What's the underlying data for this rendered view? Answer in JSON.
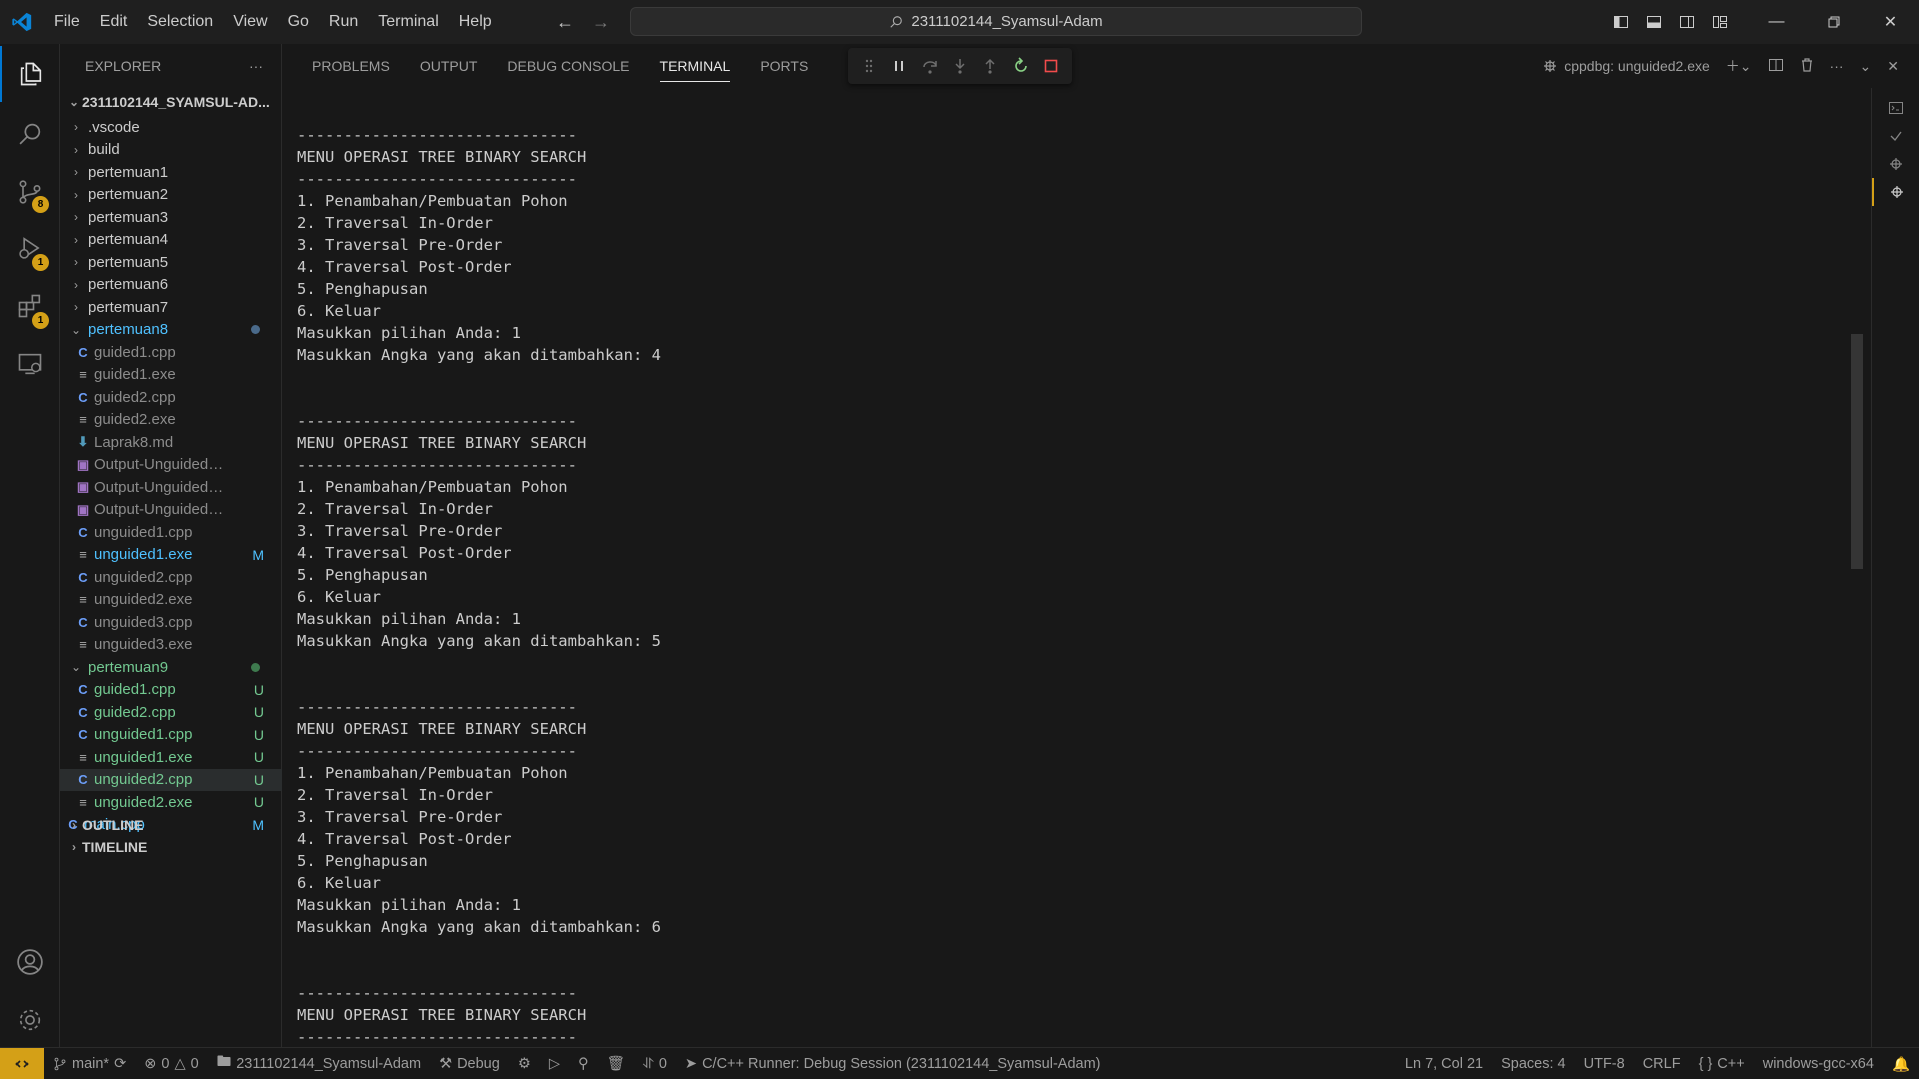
{
  "titlebar": {
    "menus": [
      "File",
      "Edit",
      "Selection",
      "View",
      "Go",
      "Run",
      "Terminal",
      "Help"
    ],
    "search_text": "2311102144_Syamsul-Adam"
  },
  "activity": {
    "scm_badge": "8",
    "debug_badge": "1",
    "extensions_badge": "1"
  },
  "explorer": {
    "title": "EXPLORER",
    "more": "···",
    "root": "2311102144_SYAMSUL-AD...",
    "items": [
      {
        "label": ".vscode",
        "kind": "folder",
        "color": "#cccccc"
      },
      {
        "label": "build",
        "kind": "folder",
        "color": "#cccccc"
      },
      {
        "label": "pertemuan1",
        "kind": "folder",
        "color": "#cccccc"
      },
      {
        "label": "pertemuan2",
        "kind": "folder",
        "color": "#cccccc"
      },
      {
        "label": "pertemuan3",
        "kind": "folder",
        "color": "#cccccc"
      },
      {
        "label": "pertemuan4",
        "kind": "folder",
        "color": "#cccccc"
      },
      {
        "label": "pertemuan5",
        "kind": "folder",
        "color": "#cccccc"
      },
      {
        "label": "pertemuan6",
        "kind": "folder",
        "color": "#cccccc"
      },
      {
        "label": "pertemuan7",
        "kind": "folder",
        "color": "#cccccc"
      },
      {
        "label": "pertemuan8",
        "kind": "open-folder",
        "color": "#4fc1ff",
        "dot": "#4a6a8a"
      },
      {
        "label": "guided1.cpp",
        "kind": "cpp",
        "color": "#8c8c8c"
      },
      {
        "label": "guided1.exe",
        "kind": "exe",
        "color": "#8c8c8c"
      },
      {
        "label": "guided2.cpp",
        "kind": "cpp",
        "color": "#8c8c8c"
      },
      {
        "label": "guided2.exe",
        "kind": "exe",
        "color": "#8c8c8c"
      },
      {
        "label": "Laprak8.md",
        "kind": "md",
        "color": "#8c8c8c"
      },
      {
        "label": "Output-Unguided-1...",
        "kind": "img",
        "color": "#8c8c8c"
      },
      {
        "label": "Output-Unguided-2...",
        "kind": "img",
        "color": "#8c8c8c"
      },
      {
        "label": "Output-Unguided-3...",
        "kind": "img",
        "color": "#8c8c8c"
      },
      {
        "label": "unguided1.cpp",
        "kind": "cpp",
        "color": "#8c8c8c"
      },
      {
        "label": "unguided1.exe",
        "kind": "exe",
        "color": "#4fc1ff",
        "deco": "M",
        "deco_color": "#4fc1ff"
      },
      {
        "label": "unguided2.cpp",
        "kind": "cpp",
        "color": "#8c8c8c"
      },
      {
        "label": "unguided2.exe",
        "kind": "exe",
        "color": "#8c8c8c"
      },
      {
        "label": "unguided3.cpp",
        "kind": "cpp",
        "color": "#8c8c8c"
      },
      {
        "label": "unguided3.exe",
        "kind": "exe",
        "color": "#8c8c8c"
      },
      {
        "label": "pertemuan9",
        "kind": "open-folder",
        "color": "#73c991",
        "dot": "#3e7a4e"
      },
      {
        "label": "guided1.cpp",
        "kind": "cpp",
        "color": "#73c991",
        "deco": "U",
        "deco_color": "#73c991"
      },
      {
        "label": "guided2.cpp",
        "kind": "cpp",
        "color": "#73c991",
        "deco": "U",
        "deco_color": "#73c991"
      },
      {
        "label": "unguided1.cpp",
        "kind": "cpp",
        "color": "#73c991",
        "deco": "U",
        "deco_color": "#73c991"
      },
      {
        "label": "unguided1.exe",
        "kind": "exe",
        "color": "#73c991",
        "deco": "U",
        "deco_color": "#73c991"
      },
      {
        "label": "unguided2.cpp",
        "kind": "cpp",
        "color": "#73c991",
        "deco": "U",
        "deco_color": "#73c991",
        "selected": true
      },
      {
        "label": "unguided2.exe",
        "kind": "exe",
        "color": "#73c991",
        "deco": "U",
        "deco_color": "#73c991"
      },
      {
        "label": "main.cpp",
        "kind": "cpp",
        "color": "#4fc1ff",
        "deco": "M",
        "deco_color": "#4fc1ff"
      }
    ],
    "outline": "OUTLINE",
    "timeline": "TIMELINE"
  },
  "panel": {
    "tabs": [
      "PROBLEMS",
      "OUTPUT",
      "DEBUG CONSOLE",
      "TERMINAL",
      "PORTS"
    ],
    "active_tab": "TERMINAL",
    "session": "cppdbg: unguided2.exe",
    "terminal_lines": [
      "",
      "------------------------------",
      "MENU OPERASI TREE BINARY SEARCH",
      "------------------------------",
      "1. Penambahan/Pembuatan Pohon",
      "2. Traversal In-Order",
      "3. Traversal Pre-Order",
      "4. Traversal Post-Order",
      "5. Penghapusan",
      "6. Keluar",
      "Masukkan pilihan Anda: 1",
      "Masukkan Angka yang akan ditambahkan: 4",
      "",
      "",
      "------------------------------",
      "MENU OPERASI TREE BINARY SEARCH",
      "------------------------------",
      "1. Penambahan/Pembuatan Pohon",
      "2. Traversal In-Order",
      "3. Traversal Pre-Order",
      "4. Traversal Post-Order",
      "5. Penghapusan",
      "6. Keluar",
      "Masukkan pilihan Anda: 1",
      "Masukkan Angka yang akan ditambahkan: 5",
      "",
      "",
      "------------------------------",
      "MENU OPERASI TREE BINARY SEARCH",
      "------------------------------",
      "1. Penambahan/Pembuatan Pohon",
      "2. Traversal In-Order",
      "3. Traversal Pre-Order",
      "4. Traversal Post-Order",
      "5. Penghapusan",
      "6. Keluar",
      "Masukkan pilihan Anda: 1",
      "Masukkan Angka yang akan ditambahkan: 6",
      "",
      "",
      "------------------------------",
      "MENU OPERASI TREE BINARY SEARCH",
      "------------------------------"
    ]
  },
  "statusbar": {
    "branch": "main*",
    "errors": "0",
    "warnings": "0",
    "workspace": "2311102144_Syamsul-Adam",
    "debug": "Debug",
    "ports": "0",
    "runner": "C/C++ Runner: Debug Session (2311102144_Syamsul-Adam)",
    "position": "Ln 7, Col 21",
    "spaces": "Spaces: 4",
    "encoding": "UTF-8",
    "eol": "CRLF",
    "language": "C++",
    "language_icon": "{ }",
    "compiler": "windows-gcc-x64"
  }
}
